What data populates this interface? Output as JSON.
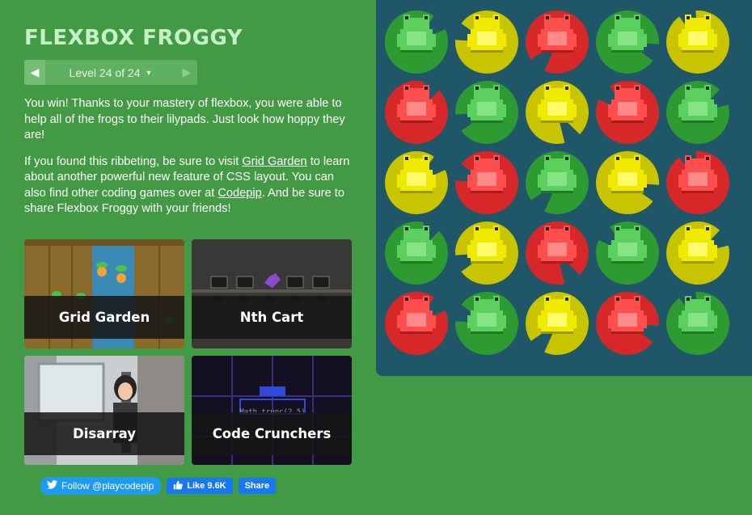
{
  "header": {
    "title": "FLEXBOX FROGGY",
    "level_label": "Level 24 of 24",
    "prev_icon": "chevron-left-icon",
    "next_icon": "chevron-right-icon"
  },
  "instructions": {
    "p1": "You win! Thanks to your mastery of flexbox, you were able to help all of the frogs to their lilypads. Just look how hoppy they are!",
    "p2_a": "If you found this ribbeting, be sure to visit ",
    "p2_link1": "Grid Garden",
    "p2_b": " to learn about another powerful new feature of CSS layout. You can also find other coding games over at ",
    "p2_link2": "Codepip",
    "p2_c": ". And be sure to share Flexbox Froggy with your friends!"
  },
  "games": [
    {
      "label": "Grid Garden"
    },
    {
      "label": "Nth Cart"
    },
    {
      "label": "Disarray"
    },
    {
      "label": "Code Crunchers"
    }
  ],
  "game_snippet": "Math.trunc(2.5)",
  "social": {
    "twitter_label": "Follow @playcodepip",
    "like_label": "Like 9.6K",
    "share_label": "Share"
  },
  "colors": {
    "green": "#2e9b32",
    "yellow": "#d4d000",
    "red": "#d92c2c",
    "pond": "#1f5768",
    "page": "#439a45"
  },
  "pond": {
    "rows": [
      [
        "green",
        "yellow",
        "red",
        "green",
        "yellow"
      ],
      [
        "red",
        "green",
        "yellow",
        "red",
        "green"
      ],
      [
        "yellow",
        "red",
        "green",
        "yellow",
        "red"
      ],
      [
        "green",
        "yellow",
        "red",
        "green",
        "yellow"
      ],
      [
        "red",
        "green",
        "yellow",
        "red",
        "green"
      ]
    ]
  }
}
